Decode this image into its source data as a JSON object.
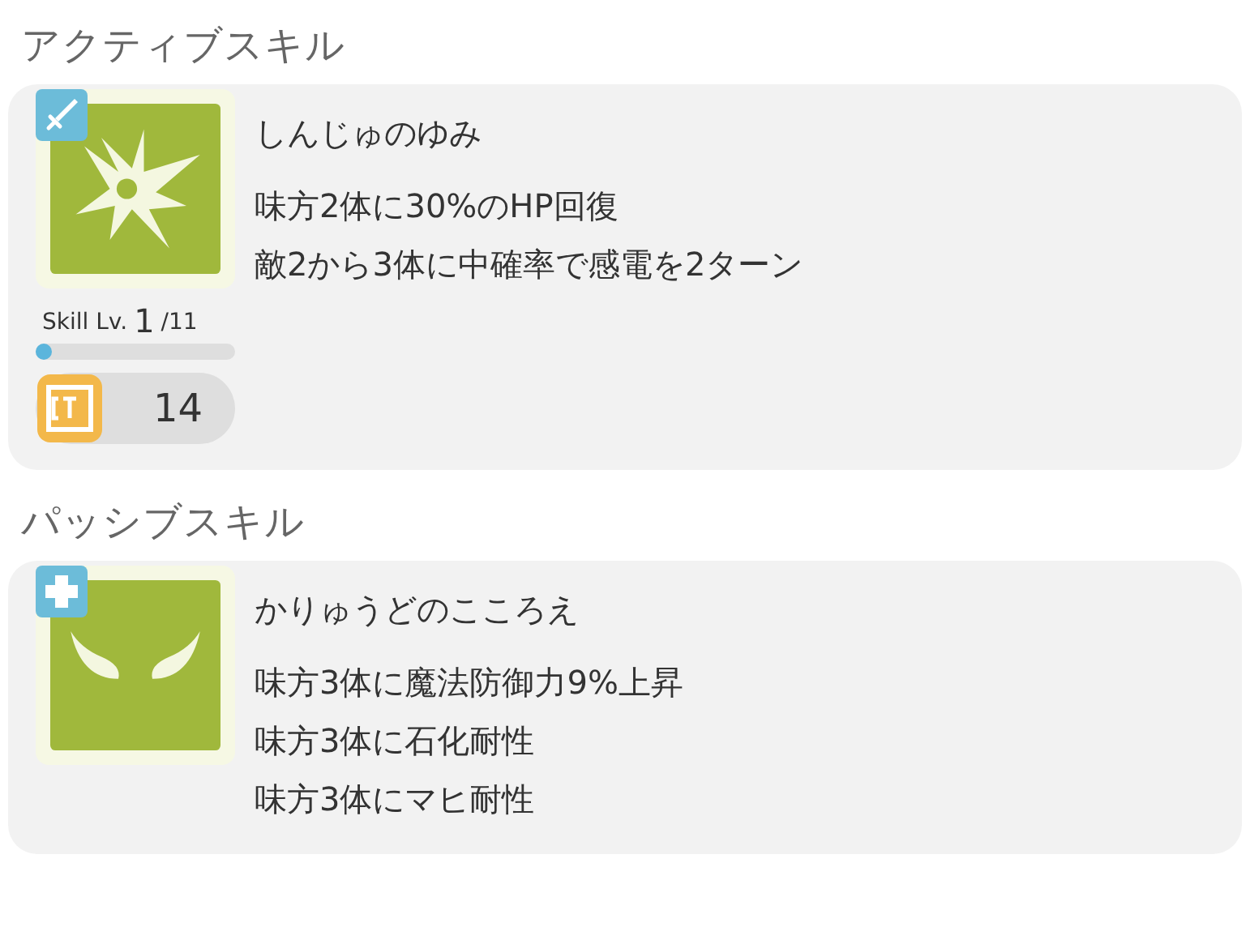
{
  "sections": [
    {
      "title": "アクティブスキル",
      "skills": [
        {
          "name": "しんじゅのゆみ",
          "kind": "active",
          "effects": [
            "味方2体に30%のHP回復",
            "敵2から3体に中確率で感電を2ターン"
          ],
          "skill_level": {
            "label": "Skill Lv.",
            "current": "1",
            "max": "/11",
            "level": 0.07
          },
          "ct": "14"
        }
      ]
    },
    {
      "title": "パッシブスキル",
      "skills": [
        {
          "name": "かりゅうどのこころえ",
          "kind": "passive",
          "effects": [
            "味方3体に魔法防御力9%上昇",
            "味方3体に石化耐性",
            "味方3体にマヒ耐性"
          ]
        }
      ]
    }
  ]
}
